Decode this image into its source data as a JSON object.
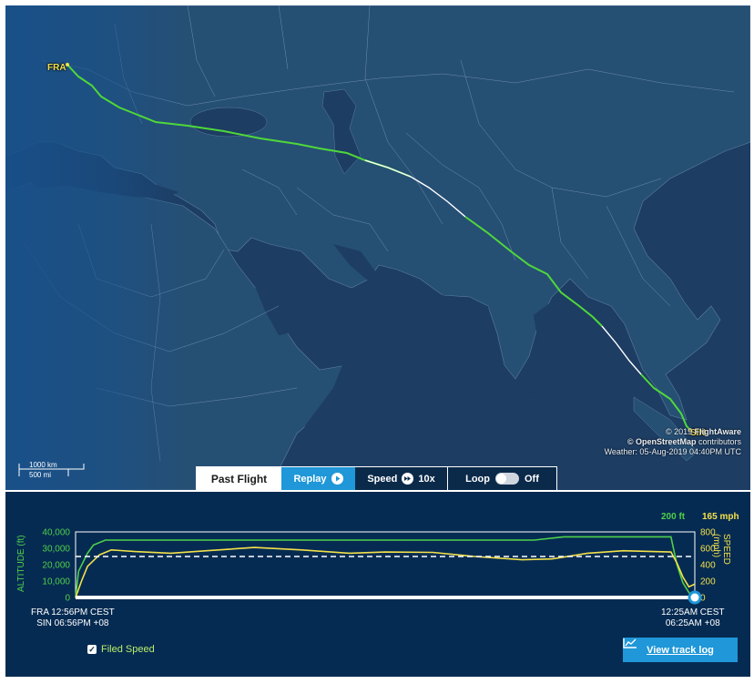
{
  "map": {
    "origin_code": "FRA",
    "destination_code": "SIN",
    "attribution": {
      "line1_prefix": "© 2019 ",
      "line1_brand": "FlightAware",
      "line2_brand": "© OpenStreetMap",
      "line2_suffix": " contributors",
      "weather": "Weather: 05-Aug-2019 04:40PM UTC"
    },
    "scale": {
      "km": "1000 km",
      "mi": "500 mi"
    }
  },
  "controls": {
    "past_flight": "Past Flight",
    "replay": "Replay",
    "speed_label": "Speed",
    "speed_value": "10x",
    "loop_label": "Loop",
    "loop_state": "Off"
  },
  "chart_data": {
    "type": "line",
    "left_axis": {
      "title": "ALTITUDE (ft)",
      "ticks": [
        "40,000",
        "30,000",
        "20,000",
        "10,000",
        "0"
      ],
      "ylim": [
        0,
        40000
      ],
      "color": "#4ed04a"
    },
    "right_axis": {
      "title": "SPEED (mph)",
      "ticks": [
        "800",
        "600",
        "400",
        "200",
        "0"
      ],
      "ylim": [
        0,
        800
      ],
      "color": "#f3e14a"
    },
    "current_altitude": "200 ft",
    "current_speed": "165 mph",
    "series": [
      {
        "name": "Altitude",
        "color": "#4ed04a",
        "x": [
          0,
          0.5,
          2,
          3,
          5,
          8,
          19,
          26,
          34,
          45,
          57,
          66,
          73,
          77,
          82,
          90,
          93,
          100,
          101,
          102,
          103,
          104
        ],
        "y": [
          0,
          16000,
          27000,
          32000,
          35000,
          35000,
          35000,
          35000,
          35000,
          35000,
          35000,
          35000,
          35000,
          35000,
          37000,
          37000,
          37000,
          37000,
          20000,
          9000,
          3000,
          200
        ]
      },
      {
        "name": "Speed",
        "color": "#f3e14a",
        "x": [
          0,
          1,
          2,
          4,
          6,
          10,
          16,
          22,
          30,
          38,
          46,
          52,
          60,
          67,
          75,
          80,
          86,
          92,
          97,
          100,
          101,
          102,
          103,
          104
        ],
        "y": [
          0,
          200,
          380,
          520,
          580,
          560,
          540,
          570,
          610,
          580,
          540,
          555,
          550,
          500,
          460,
          470,
          540,
          570,
          560,
          555,
          420,
          250,
          130,
          165
        ]
      },
      {
        "name": "Filed Speed",
        "color": "#ffffff",
        "x": [
          0,
          104
        ],
        "y": [
          500,
          500
        ]
      }
    ],
    "x_start": {
      "origin": "FRA 12:56PM CEST",
      "destination": "SIN 06:56PM +08"
    },
    "x_end": {
      "origin": "12:25AM CEST",
      "destination": "06:25AM +08"
    }
  },
  "footer": {
    "filed_speed": "Filed Speed",
    "view_track_log": "View track log"
  },
  "colors": {
    "track": "#4fd839",
    "gap": "#ffffff",
    "land": "#264f74",
    "sea": "#1d3d63",
    "night": "#1b4b78",
    "accent": "#1f97d8",
    "panel": "#062b52"
  }
}
